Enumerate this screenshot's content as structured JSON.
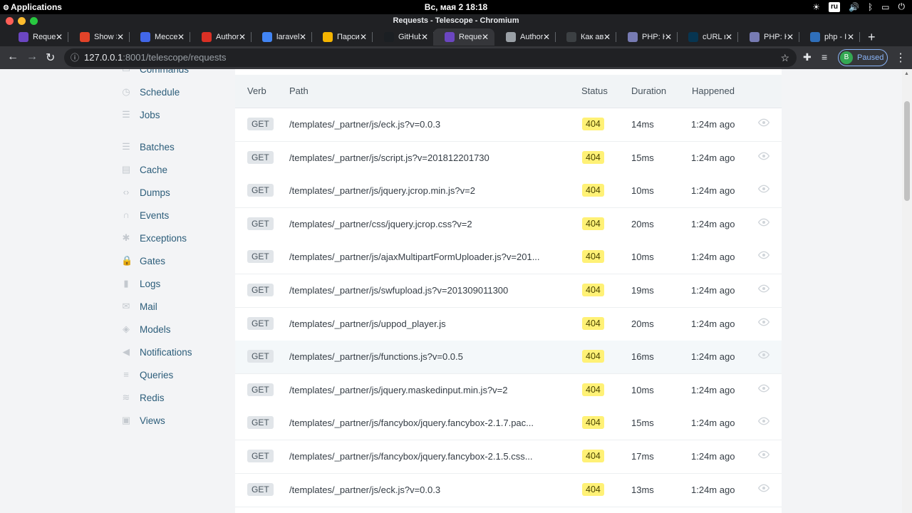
{
  "topbar": {
    "applications": "Applications",
    "datetime": "Вс, мая  2   18:18",
    "lang": "ru"
  },
  "window": {
    "title": "Requests - Telescope - Chromium"
  },
  "tabs": [
    {
      "title": "Reque",
      "fav_color": "#6b46c1",
      "active": false
    },
    {
      "title": "Show S",
      "fav_color": "#e24329",
      "active": false
    },
    {
      "title": "Мессе",
      "fav_color": "#4267e8",
      "active": false
    },
    {
      "title": "Author",
      "fav_color": "#d93025",
      "active": false
    },
    {
      "title": "laravel",
      "fav_color": "#4285f4",
      "active": false
    },
    {
      "title": "Парси",
      "fav_color": "#f4b400",
      "active": false
    },
    {
      "title": "GitHub",
      "fav_color": "#1b1f23",
      "active": false
    },
    {
      "title": "Reque",
      "fav_color": "#6b46c1",
      "active": true
    },
    {
      "title": "Author",
      "fav_color": "#9aa0a6",
      "active": false
    },
    {
      "title": "Как ав",
      "fav_color": "#3c4043",
      "active": false
    },
    {
      "title": "PHP: H",
      "fav_color": "#777bb3",
      "active": false
    },
    {
      "title": "cURL n",
      "fav_color": "#073551",
      "active": false
    },
    {
      "title": "PHP: H",
      "fav_color": "#777bb3",
      "active": false
    },
    {
      "title": "php - I",
      "fav_color": "#2f6fba",
      "active": false
    }
  ],
  "toolbar": {
    "url_host": "127.0.0.1",
    "url_rest": ":8001/telescope/requests",
    "profile_initial": "B",
    "profile_label": "Paused"
  },
  "sidebar": {
    "items": [
      {
        "label": "Commands",
        "icon": "terminal-icon"
      },
      {
        "label": "Schedule",
        "icon": "clock-icon"
      },
      {
        "label": "Jobs",
        "icon": "list-icon"
      },
      {
        "label": "Batches",
        "icon": "stack-icon"
      },
      {
        "label": "Cache",
        "icon": "cache-icon"
      },
      {
        "label": "Dumps",
        "icon": "code-icon"
      },
      {
        "label": "Events",
        "icon": "headphones-icon"
      },
      {
        "label": "Exceptions",
        "icon": "bug-icon"
      },
      {
        "label": "Gates",
        "icon": "lock-icon"
      },
      {
        "label": "Logs",
        "icon": "journal-icon"
      },
      {
        "label": "Mail",
        "icon": "mail-icon"
      },
      {
        "label": "Models",
        "icon": "layers-icon"
      },
      {
        "label": "Notifications",
        "icon": "megaphone-icon"
      },
      {
        "label": "Queries",
        "icon": "database-icon"
      },
      {
        "label": "Redis",
        "icon": "redis-icon"
      },
      {
        "label": "Views",
        "icon": "window-icon"
      }
    ]
  },
  "table": {
    "headers": {
      "verb": "Verb",
      "path": "Path",
      "status": "Status",
      "duration": "Duration",
      "happened": "Happened"
    },
    "rows": [
      {
        "verb": "GET",
        "path": "/templates/_partner/js/eck.js?v=0.0.3",
        "status": "404",
        "duration": "14ms",
        "happened": "1:24m ago"
      },
      {
        "verb": "GET",
        "path": "/templates/_partner/js/script.js?v=201812201730",
        "status": "404",
        "duration": "15ms",
        "happened": "1:24m ago"
      },
      {
        "verb": "GET",
        "path": "/templates/_partner/js/jquery.jcrop.min.js?v=2",
        "status": "404",
        "duration": "10ms",
        "happened": "1:24m ago"
      },
      {
        "verb": "GET",
        "path": "/templates/_partner/css/jquery.jcrop.css?v=2",
        "status": "404",
        "duration": "20ms",
        "happened": "1:24m ago"
      },
      {
        "verb": "GET",
        "path": "/templates/_partner/js/ajaxMultipartFormUploader.js?v=201...",
        "status": "404",
        "duration": "10ms",
        "happened": "1:24m ago"
      },
      {
        "verb": "GET",
        "path": "/templates/_partner/js/swfupload.js?v=201309011300",
        "status": "404",
        "duration": "19ms",
        "happened": "1:24m ago"
      },
      {
        "verb": "GET",
        "path": "/templates/_partner/js/uppod_player.js",
        "status": "404",
        "duration": "20ms",
        "happened": "1:24m ago"
      },
      {
        "verb": "GET",
        "path": "/templates/_partner/js/functions.js?v=0.0.5",
        "status": "404",
        "duration": "16ms",
        "happened": "1:24m ago"
      },
      {
        "verb": "GET",
        "path": "/templates/_partner/js/jquery.maskedinput.min.js?v=2",
        "status": "404",
        "duration": "10ms",
        "happened": "1:24m ago"
      },
      {
        "verb": "GET",
        "path": "/templates/_partner/js/fancybox/jquery.fancybox-2.1.7.pac...",
        "status": "404",
        "duration": "15ms",
        "happened": "1:24m ago"
      },
      {
        "verb": "GET",
        "path": "/templates/_partner/js/fancybox/jquery.fancybox-2.1.5.css...",
        "status": "404",
        "duration": "17ms",
        "happened": "1:24m ago"
      },
      {
        "verb": "GET",
        "path": "/templates/_partner/js/eck.js?v=0.0.3",
        "status": "404",
        "duration": "13ms",
        "happened": "1:24m ago"
      }
    ]
  }
}
